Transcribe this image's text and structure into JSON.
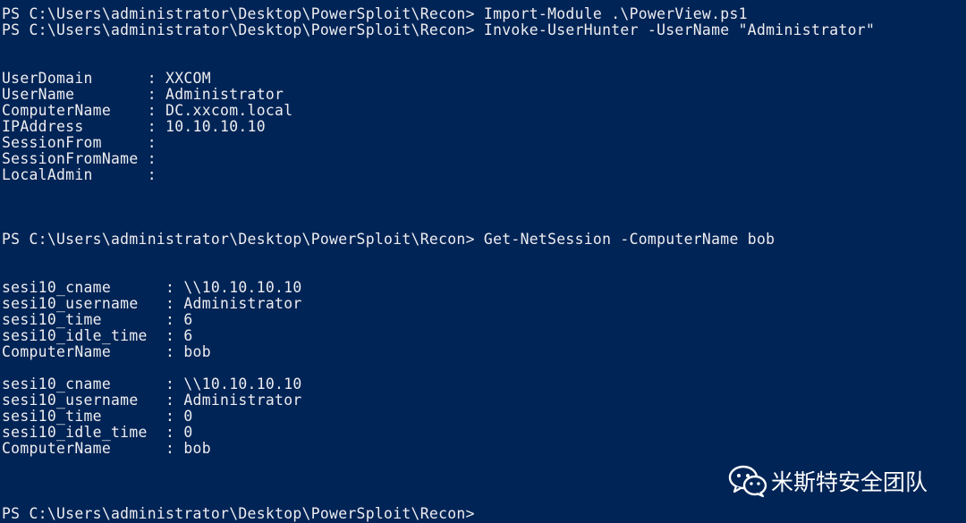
{
  "console": {
    "lines": [
      "PS C:\\Users\\administrator\\Desktop\\PowerSploit\\Recon> Import-Module .\\PowerView.ps1",
      "PS C:\\Users\\administrator\\Desktop\\PowerSploit\\Recon> Invoke-UserHunter -UserName \"Administrator\"",
      "",
      "",
      "UserDomain      : XXCOM",
      "UserName        : Administrator",
      "ComputerName    : DC.xxcom.local",
      "IPAddress       : 10.10.10.10",
      "SessionFrom     :",
      "SessionFromName :",
      "LocalAdmin      :",
      "",
      "",
      "",
      "PS C:\\Users\\administrator\\Desktop\\PowerSploit\\Recon> Get-NetSession -ComputerName bob",
      "",
      "",
      "sesi10_cname      : \\\\10.10.10.10",
      "sesi10_username   : Administrator",
      "sesi10_time       : 6",
      "sesi10_idle_time  : 6",
      "ComputerName      : bob",
      "",
      "sesi10_cname      : \\\\10.10.10.10",
      "sesi10_username   : Administrator",
      "sesi10_time       : 0",
      "sesi10_idle_time  : 0",
      "ComputerName      : bob",
      "",
      "",
      "",
      "PS C:\\Users\\administrator\\Desktop\\PowerSploit\\Recon>"
    ]
  },
  "watermark": {
    "text": "米斯特安全团队",
    "icon": "wechat-icon"
  },
  "colors": {
    "background": "#012456",
    "foreground": "#eeedf0"
  }
}
